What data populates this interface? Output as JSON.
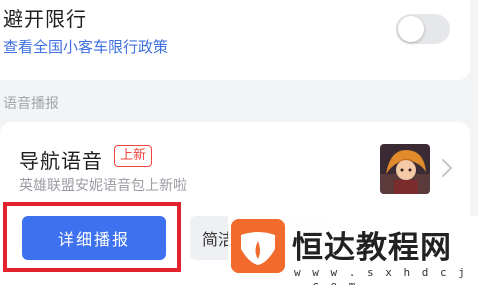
{
  "route_restriction": {
    "title": "避开限行",
    "policy_link": "查看全国小客车限行政策",
    "toggle_on": false
  },
  "voice_section": {
    "label": "语音播报"
  },
  "nav_voice": {
    "title": "导航语音",
    "badge": "上新",
    "subtitle": "英雄联盟安妮语音包上新啦",
    "avatar_icon": "character-avatar-icon"
  },
  "broadcast_mode": {
    "detailed_label": "详细播报",
    "simple_label": "简洁播报",
    "selected": "详细播报"
  },
  "watermark": {
    "name": "恒达教程网",
    "url": "w w w . s x h d c j . c o m"
  },
  "colors": {
    "accent": "#3d71f0",
    "badge_red": "#f2453d",
    "highlight_red": "#e2232d",
    "logo_orange": "#f26b2c"
  }
}
